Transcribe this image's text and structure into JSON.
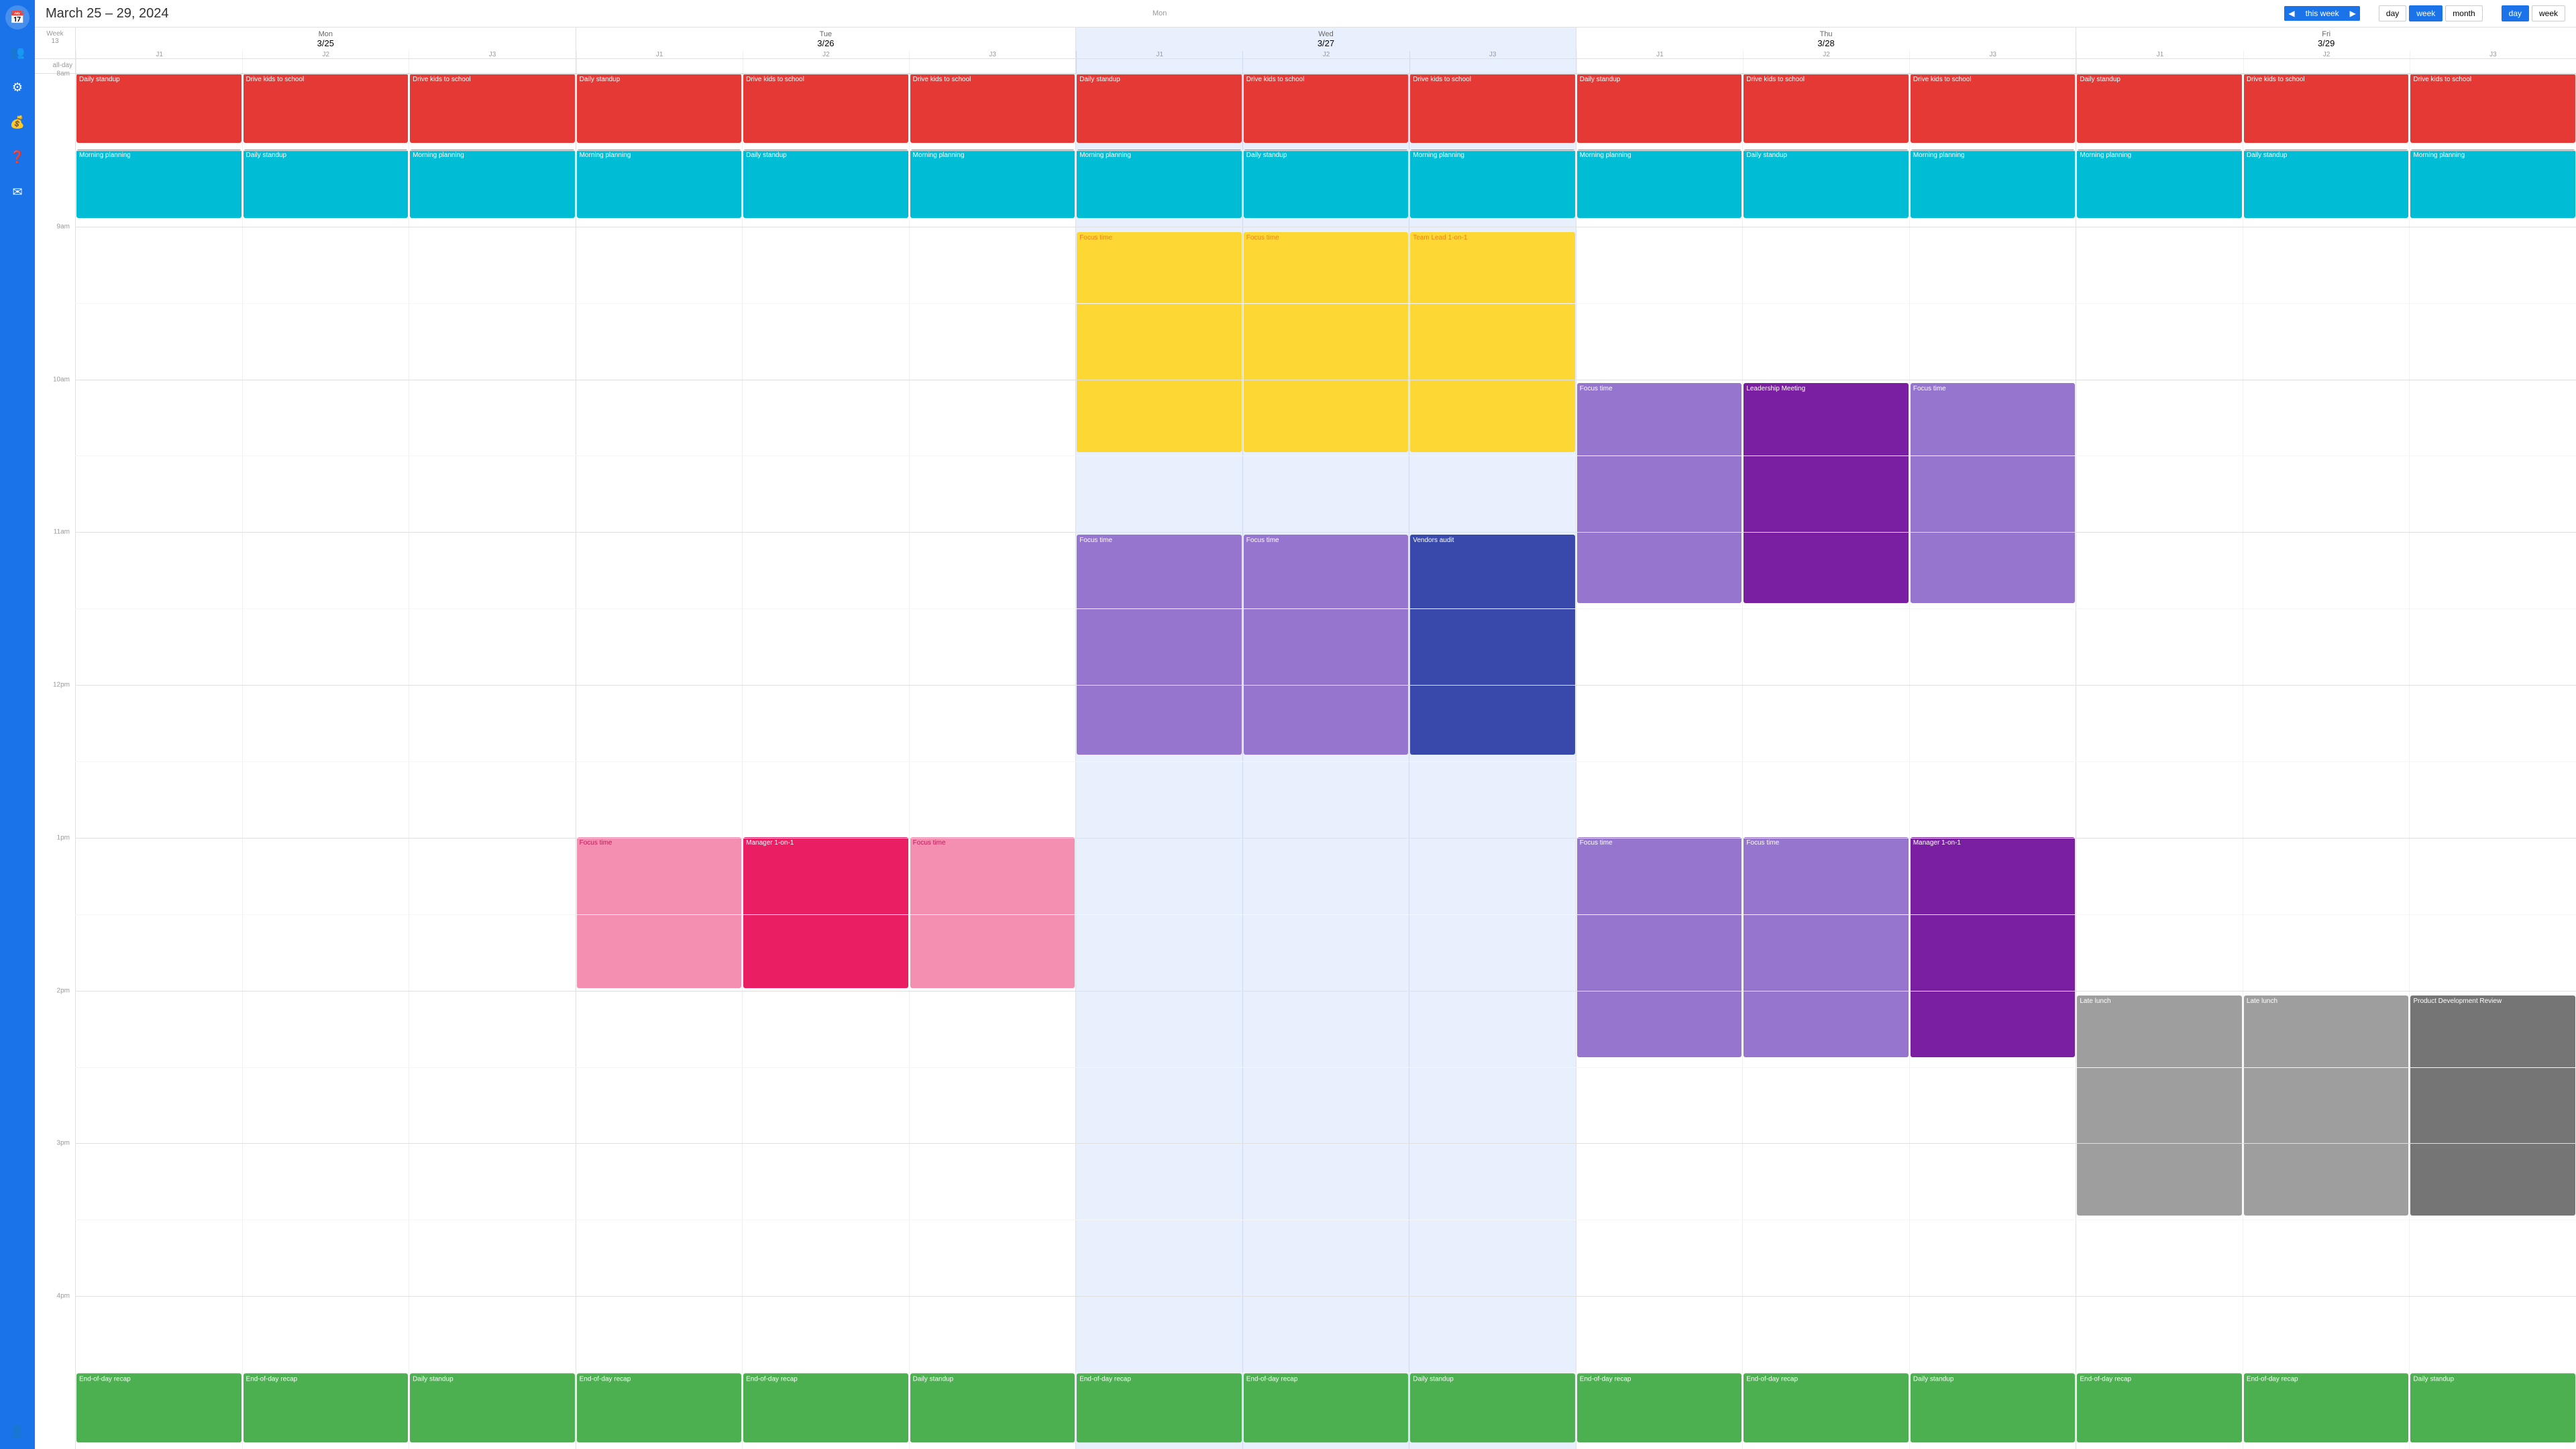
{
  "header": {
    "title": "March 25 – 29, 2024",
    "week_label": "Week 13",
    "nav": {
      "prev_arrow": "◀",
      "next_arrow": "▶",
      "this_week": "this week"
    },
    "view_options": [
      "day",
      "week",
      "month"
    ],
    "view2_options": [
      "day",
      "week"
    ]
  },
  "sidebar": {
    "icons": [
      {
        "name": "calendar-icon",
        "symbol": "📅",
        "active": true
      },
      {
        "name": "people-icon",
        "symbol": "👥",
        "active": false
      },
      {
        "name": "settings-icon",
        "symbol": "⚙",
        "active": false
      },
      {
        "name": "money-icon",
        "symbol": "💰",
        "active": false
      },
      {
        "name": "help-icon",
        "symbol": "❓",
        "active": false
      },
      {
        "name": "mail-icon",
        "symbol": "✉",
        "active": false
      }
    ],
    "user_icon": "👤"
  },
  "calendar": {
    "days": [
      {
        "name": "Mon",
        "date": "3/25",
        "sub": [
          "J1",
          "J2",
          "J3"
        ]
      },
      {
        "name": "Tue",
        "date": "3/26",
        "sub": [
          "J1",
          "J2",
          "J3"
        ]
      },
      {
        "name": "Wed",
        "date": "3/27",
        "sub": [
          "J1",
          "J2",
          "J3"
        ]
      },
      {
        "name": "Thu",
        "date": "3/28",
        "sub": [
          "J1",
          "J2",
          "J3"
        ]
      },
      {
        "name": "Fri",
        "date": "3/29",
        "sub": [
          "J1",
          "J2",
          "J3"
        ]
      }
    ],
    "time_labels": [
      "8am",
      "9am",
      "10am",
      "11am",
      "12pm",
      "1pm",
      "2pm",
      "3pm",
      "4pm"
    ],
    "events": [
      {
        "day": 0,
        "sub": 0,
        "label": "Daily standup",
        "color": "#e53935",
        "text_color": "white",
        "top_pct": 0,
        "height_pct": 4,
        "start_hour": 8.0
      },
      {
        "day": 0,
        "sub": 1,
        "label": "Drive kids to school",
        "color": "#e53935",
        "text_color": "white",
        "top_pct": 0,
        "height_pct": 4,
        "start_hour": 8.0
      },
      {
        "day": 0,
        "sub": 2,
        "label": "Drive kids to school",
        "color": "#e53935",
        "text_color": "white",
        "top_pct": 0,
        "height_pct": 4,
        "start_hour": 8.0
      },
      {
        "day": 0,
        "sub": 0,
        "label": "Morning planning",
        "color": "#00bcd4",
        "text_color": "white",
        "top_pct": 5,
        "height_pct": 5,
        "start_hour": 8.5
      },
      {
        "day": 0,
        "sub": 1,
        "label": "Daily standup",
        "color": "#00bcd4",
        "text_color": "white",
        "top_pct": 5,
        "height_pct": 5,
        "start_hour": 8.5
      },
      {
        "day": 0,
        "sub": 2,
        "label": "Morning planning",
        "color": "#00bcd4",
        "text_color": "white",
        "top_pct": 5,
        "height_pct": 5,
        "start_hour": 8.5
      },
      {
        "day": 1,
        "sub": 0,
        "label": "Daily standup",
        "color": "#e53935",
        "text_color": "white",
        "top_pct": 0,
        "height_pct": 4,
        "start_hour": 8.0
      },
      {
        "day": 1,
        "sub": 1,
        "label": "Drive kids to school",
        "color": "#e53935",
        "text_color": "white",
        "top_pct": 0,
        "height_pct": 4,
        "start_hour": 8.0
      },
      {
        "day": 1,
        "sub": 2,
        "label": "Drive kids to school",
        "color": "#e53935",
        "text_color": "white",
        "top_pct": 0,
        "height_pct": 4,
        "start_hour": 8.0
      },
      {
        "day": 1,
        "sub": 0,
        "label": "Morning planning",
        "color": "#00bcd4",
        "text_color": "white",
        "top_pct": 5,
        "height_pct": 5,
        "start_hour": 8.5
      },
      {
        "day": 1,
        "sub": 1,
        "label": "Daily standup",
        "color": "#00bcd4",
        "text_color": "white",
        "top_pct": 5,
        "height_pct": 5,
        "start_hour": 8.5
      },
      {
        "day": 1,
        "sub": 2,
        "label": "Morning planning",
        "color": "#00bcd4",
        "text_color": "white",
        "top_pct": 5,
        "height_pct": 5,
        "start_hour": 8.5
      },
      {
        "day": 1,
        "sub": 0,
        "label": "Focus time",
        "color": "#f48fb1",
        "text_color": "#c2185b",
        "start_hour": 13.0,
        "end_hour": 14.0
      },
      {
        "day": 1,
        "sub": 1,
        "label": "Manager 1-on-1",
        "color": "#e91e63",
        "text_color": "white",
        "start_hour": 13.0,
        "end_hour": 14.0
      },
      {
        "day": 1,
        "sub": 2,
        "label": "Focus time",
        "color": "#f48fb1",
        "text_color": "#c2185b",
        "start_hour": 13.0,
        "end_hour": 14.0
      },
      {
        "day": 2,
        "sub": 0,
        "label": "Daily standup",
        "color": "#e53935",
        "text_color": "white",
        "start_hour": 8.0,
        "end_hour": 8.5
      },
      {
        "day": 2,
        "sub": 1,
        "label": "Drive kids to school",
        "color": "#e53935",
        "text_color": "white",
        "start_hour": 8.0,
        "end_hour": 8.5
      },
      {
        "day": 2,
        "sub": 2,
        "label": "Drive kids to school",
        "color": "#e53935",
        "text_color": "white",
        "start_hour": 8.0,
        "end_hour": 8.5
      },
      {
        "day": 2,
        "sub": 0,
        "label": "Morning planning",
        "color": "#00bcd4",
        "text_color": "white",
        "start_hour": 8.5,
        "end_hour": 9.0
      },
      {
        "day": 2,
        "sub": 1,
        "label": "Daily standup",
        "color": "#00bcd4",
        "text_color": "white",
        "start_hour": 8.5,
        "end_hour": 9.0
      },
      {
        "day": 2,
        "sub": 2,
        "label": "Morning planning",
        "color": "#00bcd4",
        "text_color": "white",
        "start_hour": 8.5,
        "end_hour": 9.0
      },
      {
        "day": 2,
        "sub": 0,
        "label": "Focus time",
        "color": "#fdd835",
        "text_color": "#f57f17",
        "start_hour": 9.0,
        "end_hour": 10.5
      },
      {
        "day": 2,
        "sub": 1,
        "label": "Focus time",
        "color": "#fdd835",
        "text_color": "#f57f17",
        "start_hour": 9.0,
        "end_hour": 10.5
      },
      {
        "day": 2,
        "sub": 2,
        "label": "Team Lead 1-on-1",
        "color": "#fdd835",
        "text_color": "#f57f17",
        "start_hour": 9.0,
        "end_hour": 10.5
      },
      {
        "day": 2,
        "sub": 0,
        "label": "Focus time",
        "color": "#9575cd",
        "text_color": "white",
        "start_hour": 11.0,
        "end_hour": 12.5
      },
      {
        "day": 2,
        "sub": 1,
        "label": "Focus time",
        "color": "#9575cd",
        "text_color": "white",
        "start_hour": 11.0,
        "end_hour": 12.5
      },
      {
        "day": 2,
        "sub": 2,
        "label": "Vendors audit",
        "color": "#3949ab",
        "text_color": "white",
        "start_hour": 11.0,
        "end_hour": 12.5
      },
      {
        "day": 2,
        "sub": 0,
        "label": "End-of-day recap",
        "color": "#4caf50",
        "text_color": "white",
        "start_hour": 17.0,
        "end_hour": 17.5
      },
      {
        "day": 2,
        "sub": 1,
        "label": "End-of-day recap",
        "color": "#4caf50",
        "text_color": "white",
        "start_hour": 17.0,
        "end_hour": 17.5
      },
      {
        "day": 2,
        "sub": 2,
        "label": "Daily standup",
        "color": "#4caf50",
        "text_color": "white",
        "start_hour": 17.0,
        "end_hour": 17.5
      },
      {
        "day": 3,
        "sub": 0,
        "label": "Daily standup",
        "color": "#e53935",
        "text_color": "white",
        "start_hour": 8.0,
        "end_hour": 8.5
      },
      {
        "day": 3,
        "sub": 1,
        "label": "Drive kids to school",
        "color": "#e53935",
        "text_color": "white",
        "start_hour": 8.0,
        "end_hour": 8.5
      },
      {
        "day": 3,
        "sub": 2,
        "label": "Drive kids to school",
        "color": "#e53935",
        "text_color": "white",
        "start_hour": 8.0,
        "end_hour": 8.5
      },
      {
        "day": 3,
        "sub": 0,
        "label": "Morning planning",
        "color": "#00bcd4",
        "text_color": "white",
        "start_hour": 8.5,
        "end_hour": 9.0
      },
      {
        "day": 3,
        "sub": 1,
        "label": "Daily standup",
        "color": "#00bcd4",
        "text_color": "white",
        "start_hour": 8.5,
        "end_hour": 9.0
      },
      {
        "day": 3,
        "sub": 2,
        "label": "Morning planning",
        "color": "#00bcd4",
        "text_color": "white",
        "start_hour": 8.5,
        "end_hour": 9.0
      },
      {
        "day": 3,
        "sub": 0,
        "label": "Focus time",
        "color": "#9575cd",
        "text_color": "white",
        "start_hour": 10.0,
        "end_hour": 11.5
      },
      {
        "day": 3,
        "sub": 1,
        "label": "Leadership Meeting",
        "color": "#7b1fa2",
        "text_color": "white",
        "start_hour": 10.0,
        "end_hour": 11.5
      },
      {
        "day": 3,
        "sub": 2,
        "label": "Focus time",
        "color": "#9575cd",
        "text_color": "white",
        "start_hour": 10.0,
        "end_hour": 11.5
      },
      {
        "day": 3,
        "sub": 0,
        "label": "Focus time",
        "color": "#9575cd",
        "text_color": "white",
        "start_hour": 13.0,
        "end_hour": 14.5
      },
      {
        "day": 3,
        "sub": 1,
        "label": "Focus time",
        "color": "#9575cd",
        "text_color": "white",
        "start_hour": 13.0,
        "end_hour": 14.5
      },
      {
        "day": 3,
        "sub": 2,
        "label": "Manager 1-on-1",
        "color": "#7b1fa2",
        "text_color": "white",
        "start_hour": 13.0,
        "end_hour": 14.5
      },
      {
        "day": 3,
        "sub": 0,
        "label": "End-of-day recap",
        "color": "#4caf50",
        "text_color": "white",
        "start_hour": 17.0,
        "end_hour": 17.5
      },
      {
        "day": 3,
        "sub": 1,
        "label": "End-of-day recap",
        "color": "#4caf50",
        "text_color": "white",
        "start_hour": 17.0,
        "end_hour": 17.5
      },
      {
        "day": 3,
        "sub": 2,
        "label": "Daily standup",
        "color": "#4caf50",
        "text_color": "white",
        "start_hour": 17.0,
        "end_hour": 17.5
      },
      {
        "day": 4,
        "sub": 0,
        "label": "Daily standup",
        "color": "#e53935",
        "text_color": "white",
        "start_hour": 8.0,
        "end_hour": 8.5
      },
      {
        "day": 4,
        "sub": 1,
        "label": "Drive kids to school",
        "color": "#e53935",
        "text_color": "white",
        "start_hour": 8.0,
        "end_hour": 8.5
      },
      {
        "day": 4,
        "sub": 2,
        "label": "Drive kids to school",
        "color": "#e53935",
        "text_color": "white",
        "start_hour": 8.0,
        "end_hour": 8.5
      },
      {
        "day": 4,
        "sub": 0,
        "label": "Morning planning",
        "color": "#00bcd4",
        "text_color": "white",
        "start_hour": 8.5,
        "end_hour": 9.0
      },
      {
        "day": 4,
        "sub": 1,
        "label": "Daily standup",
        "color": "#00bcd4",
        "text_color": "white",
        "start_hour": 8.5,
        "end_hour": 9.0
      },
      {
        "day": 4,
        "sub": 2,
        "label": "Morning planning",
        "color": "#00bcd4",
        "text_color": "white",
        "start_hour": 8.5,
        "end_hour": 9.0
      },
      {
        "day": 4,
        "sub": 0,
        "label": "Late lunch",
        "color": "#9e9e9e",
        "text_color": "white",
        "start_hour": 14.0,
        "end_hour": 15.5
      },
      {
        "day": 4,
        "sub": 1,
        "label": "Late lunch",
        "color": "#9e9e9e",
        "text_color": "white",
        "start_hour": 14.0,
        "end_hour": 15.5
      },
      {
        "day": 4,
        "sub": 2,
        "label": "Product Development Review",
        "color": "#757575",
        "text_color": "white",
        "start_hour": 14.0,
        "end_hour": 15.5
      },
      {
        "day": 4,
        "sub": 0,
        "label": "End-of-day recap",
        "color": "#4caf50",
        "text_color": "white",
        "start_hour": 17.0,
        "end_hour": 17.5
      },
      {
        "day": 4,
        "sub": 1,
        "label": "End-of-day recap",
        "color": "#4caf50",
        "text_color": "white",
        "start_hour": 17.0,
        "end_hour": 17.5
      },
      {
        "day": 4,
        "sub": 2,
        "label": "Daily standup",
        "color": "#4caf50",
        "text_color": "white",
        "start_hour": 17.0,
        "end_hour": 17.5
      }
    ],
    "mon_events_recap": [
      {
        "sub": 0,
        "label": "End-of-day recap",
        "color": "#4caf50",
        "text_color": "white",
        "start_hour": 17.0,
        "end_hour": 17.5
      },
      {
        "sub": 1,
        "label": "End-of-day recap",
        "color": "#4caf50",
        "text_color": "white",
        "start_hour": 17.0,
        "end_hour": 17.5
      },
      {
        "sub": 2,
        "label": "Daily standup",
        "color": "#4caf50",
        "text_color": "white",
        "start_hour": 17.0,
        "end_hour": 17.5
      }
    ],
    "tue_events_recap": [
      {
        "sub": 0,
        "label": "End-of-day recap",
        "color": "#4caf50",
        "text_color": "white",
        "start_hour": 17.0,
        "end_hour": 17.5
      },
      {
        "sub": 1,
        "label": "End-of-day recap",
        "color": "#4caf50",
        "text_color": "white",
        "start_hour": 17.0,
        "end_hour": 17.5
      },
      {
        "sub": 2,
        "label": "Daily standup",
        "color": "#4caf50",
        "text_color": "white",
        "start_hour": 17.0,
        "end_hour": 17.5
      }
    ]
  }
}
